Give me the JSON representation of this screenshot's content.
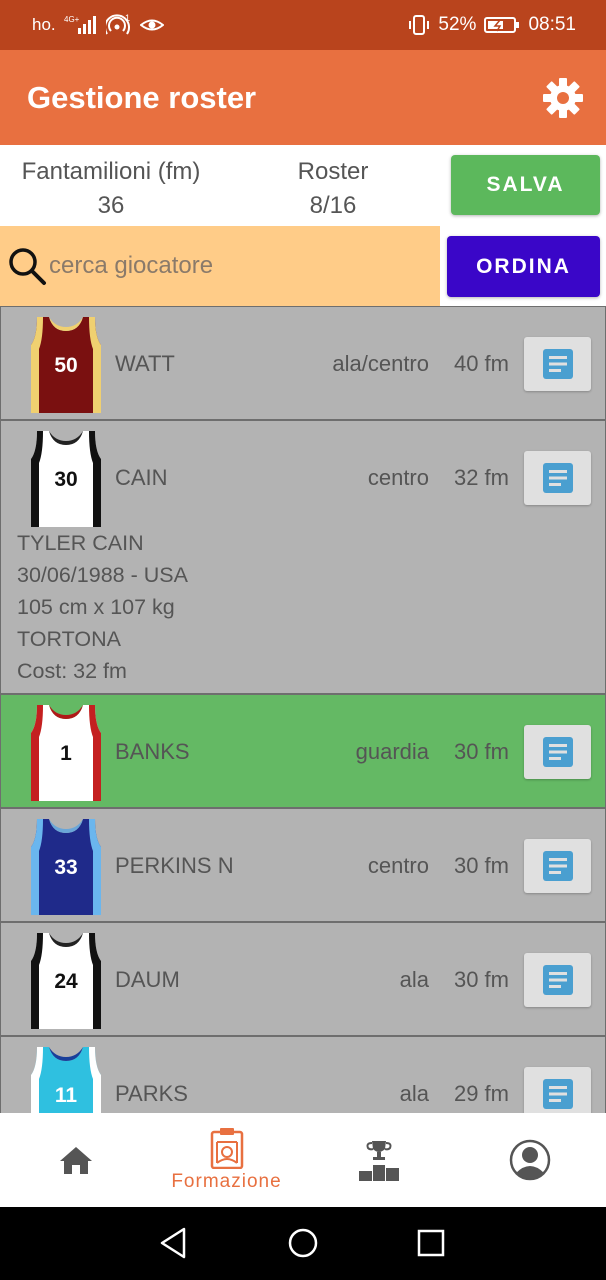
{
  "status_bar": {
    "carrier": "ho.",
    "network": "4G+",
    "notification_count": "1",
    "battery": "52%",
    "time": "08:51"
  },
  "app_bar": {
    "title": "Gestione roster",
    "settings_icon": "gear-icon"
  },
  "summary": {
    "fm_label": "Fantamilioni (fm)",
    "fm_value": "36",
    "roster_label": "Roster",
    "roster_value": "8/16",
    "save_label": "SALVA"
  },
  "search": {
    "placeholder": "cerca giocatore",
    "value": "",
    "sort_label": "ORDINA"
  },
  "players": [
    {
      "number": "50",
      "name": "WATT",
      "position": "ala/centro",
      "cost": "40 fm",
      "jersey": {
        "body": "#7a1010",
        "trim": "#f0d070",
        "neck": "#f0d070",
        "num": "#ffffff"
      }
    },
    {
      "number": "30",
      "name": "CAIN",
      "position": "centro",
      "cost": "32 fm",
      "jersey": {
        "body": "#ffffff",
        "trim": "#111111",
        "neck": "#222222",
        "num": "#111111"
      },
      "details": {
        "full_name": "TYLER CAIN",
        "birth": "30/06/1988 - USA",
        "size": "105 cm x 107 kg",
        "team": "TORTONA",
        "cost_line": "Cost: 32 fm"
      }
    },
    {
      "number": "1",
      "name": "BANKS",
      "position": "guardia",
      "cost": "30 fm",
      "jersey": {
        "body": "#ffffff",
        "trim": "#c42020",
        "neck": "#b01818",
        "num": "#111111"
      }
    },
    {
      "number": "33",
      "name": "PERKINS N",
      "position": "centro",
      "cost": "30 fm",
      "jersey": {
        "body": "#1f2a8a",
        "trim": "#6ab6ee",
        "neck": "#6aa6d8",
        "num": "#ffffff"
      }
    },
    {
      "number": "24",
      "name": "DAUM",
      "position": "ala",
      "cost": "30 fm",
      "jersey": {
        "body": "#ffffff",
        "trim": "#111111",
        "neck": "#222222",
        "num": "#111111"
      }
    },
    {
      "number": "11",
      "name": "PARKS",
      "position": "ala",
      "cost": "29 fm",
      "jersey": {
        "body": "#2fc0e0",
        "trim": "#ffffff",
        "neck": "#1a3f9a",
        "num": "#ffffff"
      }
    }
  ],
  "bottom_nav": {
    "home_icon": "home-icon",
    "formazione_label": "Formazione",
    "ranking_icon": "podium-icon",
    "profile_icon": "profile-icon"
  },
  "colors": {
    "status_bar": "#b9441d",
    "app_bar": "#e87040",
    "save_button": "#5cb85c",
    "sort_button": "#3a06c8",
    "search_bg": "#ffcc88",
    "row_bg": "#b3b3b3",
    "row_selected": "#64b964",
    "detail_icon": "#4a9fd0"
  }
}
